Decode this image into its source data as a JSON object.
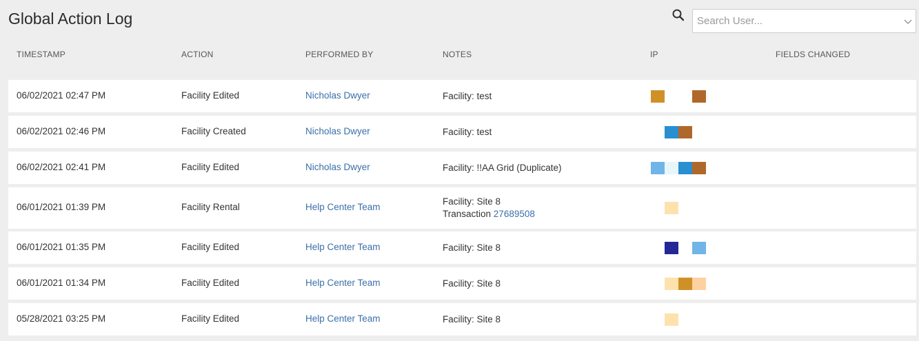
{
  "page": {
    "title": "Global Action Log"
  },
  "search": {
    "placeholder": "Search User...",
    "value": "",
    "icon": "search-icon"
  },
  "columns": {
    "timestamp": "TIMESTAMP",
    "action": "ACTION",
    "performed_by": "PERFORMED BY",
    "notes": "NOTES",
    "ip": "IP",
    "fields_changed": "FIELDS CHANGED"
  },
  "colors": {
    "link": "#3b6fa8",
    "background": "#eeeeee",
    "row": "#ffffff"
  },
  "rows": [
    {
      "timestamp": "06/02/2021 02:47 PM",
      "action": "Facility Edited",
      "performed_by": "Nicholas Dwyer",
      "notes_line1": "Facility: test",
      "notes_prefix2": "",
      "notes_link2": "",
      "fields_changed": "",
      "ip_colors": [
        "#d09028",
        "",
        "",
        "#b0682a"
      ]
    },
    {
      "timestamp": "06/02/2021 02:46 PM",
      "action": "Facility Created",
      "performed_by": "Nicholas Dwyer",
      "notes_line1": "Facility: test",
      "notes_prefix2": "",
      "notes_link2": "",
      "fields_changed": "",
      "ip_colors": [
        "",
        "#2a8fd0",
        "#b0682a",
        ""
      ]
    },
    {
      "timestamp": "06/02/2021 02:41 PM",
      "action": "Facility Edited",
      "performed_by": "Nicholas Dwyer",
      "notes_line1": "Facility: !!AA Grid (Duplicate)",
      "notes_prefix2": "",
      "notes_link2": "",
      "fields_changed": "",
      "ip_colors": [
        "#70b4e8",
        "#e8f6fc",
        "#2a8fd0",
        "#b0682a"
      ]
    },
    {
      "timestamp": "06/01/2021 01:39 PM",
      "action": "Facility Rental",
      "performed_by": "Help Center Team",
      "notes_line1": "Facility: Site 8",
      "notes_prefix2": "Transaction ",
      "notes_link2": "27689508",
      "fields_changed": "",
      "ip_colors": [
        "",
        "#fde2ae",
        "",
        ""
      ]
    },
    {
      "timestamp": "06/01/2021 01:35 PM",
      "action": "Facility Edited",
      "performed_by": "Help Center Team",
      "notes_line1": "Facility: Site 8",
      "notes_prefix2": "",
      "notes_link2": "",
      "fields_changed": "",
      "ip_colors": [
        "",
        "#232896",
        "",
        "#70b4e8"
      ]
    },
    {
      "timestamp": "06/01/2021 01:34 PM",
      "action": "Facility Edited",
      "performed_by": "Help Center Team",
      "notes_line1": "Facility: Site 8",
      "notes_prefix2": "",
      "notes_link2": "",
      "fields_changed": "",
      "ip_colors": [
        "",
        "#fde2ae",
        "#d09028",
        "#fdd2a0"
      ]
    },
    {
      "timestamp": "05/28/2021 03:25 PM",
      "action": "Facility Edited",
      "performed_by": "Help Center Team",
      "notes_line1": "Facility: Site 8",
      "notes_prefix2": "",
      "notes_link2": "",
      "fields_changed": "",
      "ip_colors": [
        "",
        "#fde2ae",
        "",
        ""
      ]
    }
  ]
}
